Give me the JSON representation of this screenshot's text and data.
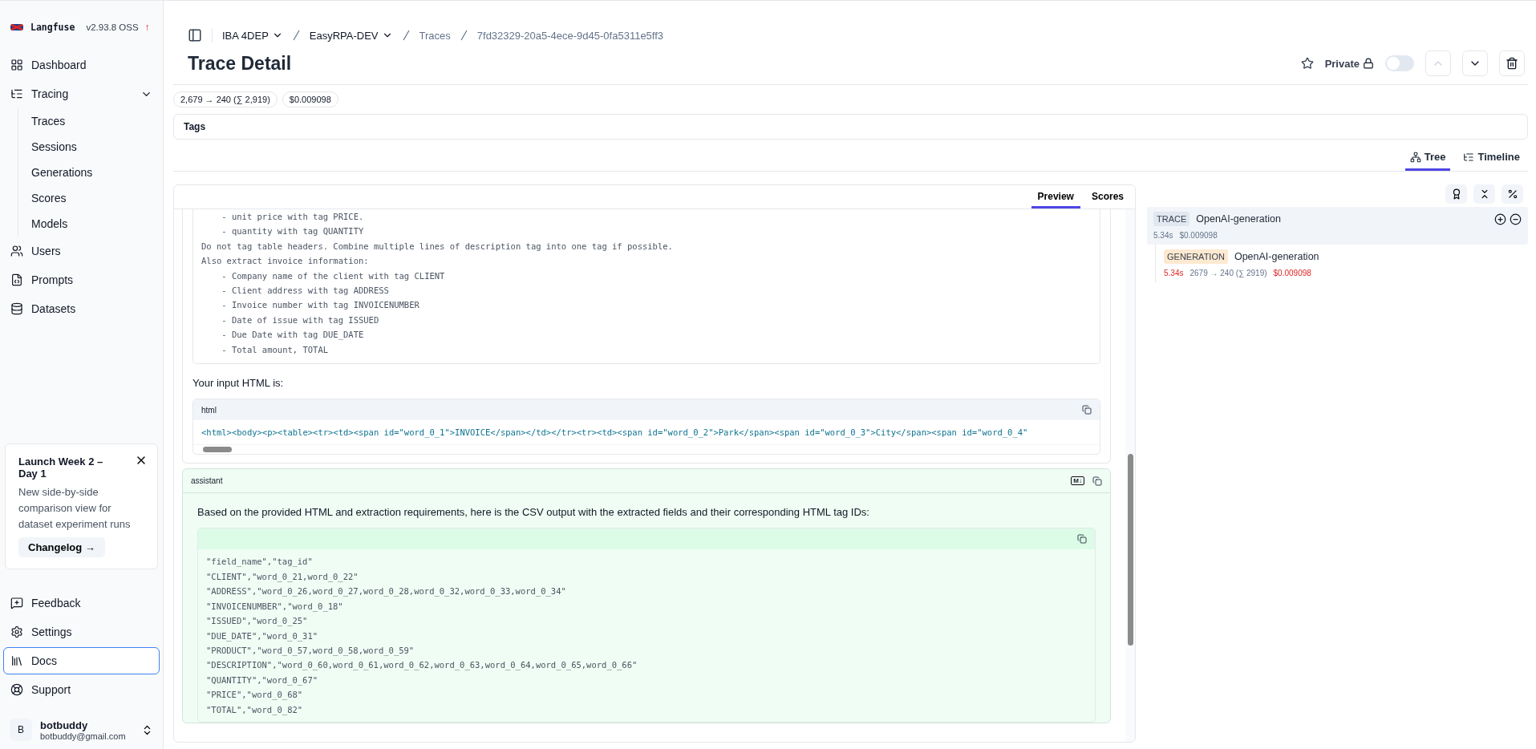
{
  "brand": {
    "name": "Langfuse",
    "version": "v2.93.8 OSS",
    "update_mark": "↑"
  },
  "nav": [
    {
      "label": "Dashboard",
      "selected": false
    },
    {
      "label": "Tracing",
      "selected": false,
      "expanded": true,
      "children": [
        {
          "label": "Traces"
        },
        {
          "label": "Sessions"
        },
        {
          "label": "Generations"
        },
        {
          "label": "Scores"
        },
        {
          "label": "Models"
        }
      ]
    },
    {
      "label": "Users",
      "selected": false
    },
    {
      "label": "Prompts",
      "selected": false
    },
    {
      "label": "Datasets",
      "selected": false
    }
  ],
  "promo": {
    "title": "Launch Week 2 – Day 1",
    "text": "New side-by-side comparison view for dataset experiment runs",
    "button": "Changelog →"
  },
  "bottom_nav": [
    {
      "label": "Feedback",
      "selected": false
    },
    {
      "label": "Settings",
      "selected": false
    },
    {
      "label": "Docs",
      "selected": true
    },
    {
      "label": "Support",
      "selected": false
    }
  ],
  "user": {
    "initial": "B",
    "name": "botbuddy",
    "email": "botbuddy@gmail.com"
  },
  "breadcrumbs": [
    {
      "label": "IBA 4DEP",
      "dropdown": true
    },
    {
      "label": "EasyRPA-DEV",
      "dropdown": true
    },
    {
      "label": "Traces",
      "dropdown": false
    },
    {
      "label": "7fd32329-20a5-4ece-9d45-0fa5311e5ff3",
      "dropdown": false
    }
  ],
  "title": "Trace Detail",
  "header_actions": {
    "private_label": "Private",
    "private_on": false
  },
  "chips": [
    "2,679 → 240 (∑ 2,919)",
    "$0.009098"
  ],
  "tags_label": "Tags",
  "view_tabs": [
    {
      "label": "Tree",
      "selected": true
    },
    {
      "label": "Timeline",
      "selected": false
    }
  ],
  "detail_tabs": [
    {
      "label": "Preview",
      "selected": true
    },
    {
      "label": "Scores",
      "selected": false
    }
  ],
  "prompt_lines": [
    "    - unit price with tag PRICE.",
    "    - quantity with tag QUANTITY",
    "Do not tag table headers. Combine multiple lines of description tag into one tag if possible.",
    "Also extract invoice information:",
    "    - Company name of the client with tag CLIENT",
    "    - Client address with tag ADDRESS",
    "    - Invoice number with tag INVOICENUMBER",
    "    - Date of issue with tag ISSUED",
    "    - Due Date with tag DUE_DATE",
    "    - Total amount, TOTAL"
  ],
  "input_label": "Your input HTML is:",
  "html_block": {
    "language": "html",
    "code": "<html><body><p><table><tr><td><span id=\"word_0_1\">INVOICE</span></td></tr><tr><td><span id=\"word_0_2\">Park</span><span id=\"word_0_3\">City</span><span id=\"word_0_4\""
  },
  "assistant": {
    "role": "assistant",
    "markdown_badge": "M↓",
    "text": "Based on the provided HTML and extraction requirements, here is the CSV output with the extracted fields and their corresponding HTML tag IDs:",
    "csv_lines": [
      "\"field_name\",\"tag_id\"",
      "\"CLIENT\",\"word_0_21,word_0_22\"",
      "\"ADDRESS\",\"word_0_26,word_0_27,word_0_28,word_0_32,word_0_33,word_0_34\"",
      "\"INVOICENUMBER\",\"word_0_18\"",
      "\"ISSUED\",\"word_0_25\"",
      "\"DUE_DATE\",\"word_0_31\"",
      "\"PRODUCT\",\"word_0_57,word_0_58,word_0_59\"",
      "\"DESCRIPTION\",\"word_0_60,word_0_61,word_0_62,word_0_63,word_0_64,word_0_65,word_0_66\"",
      "\"QUANTITY\",\"word_0_67\"",
      "\"PRICE\",\"word_0_68\"",
      "\"TOTAL\",\"word_0_82\""
    ]
  },
  "tree": [
    {
      "type": "TRACE",
      "name": "OpenAI-generation",
      "selected": true,
      "latency": "5.34s",
      "cost": "$0.009098",
      "children": [
        {
          "type": "GENERATION",
          "name": "OpenAI-generation",
          "selected": false,
          "latency": "5.34s",
          "tokens": "2679 → 240 (∑ 2919)",
          "cost": "$0.009098"
        }
      ]
    }
  ]
}
